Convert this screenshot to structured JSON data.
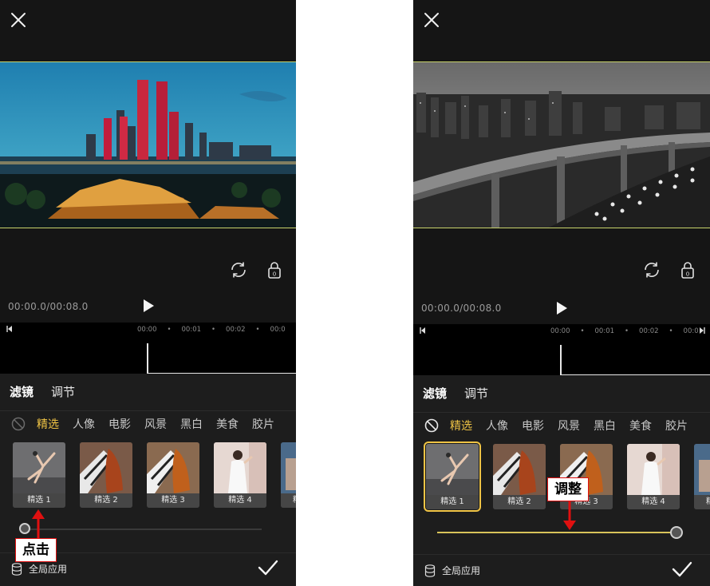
{
  "left": {
    "time": "00:00.0/00:08.0",
    "ruler": [
      "00:00",
      "•",
      "00:01",
      "•",
      "00:02",
      "•",
      "00:0"
    ],
    "tabs": [
      "滤镜",
      "调节"
    ],
    "categories": [
      "精选",
      "人像",
      "电影",
      "风景",
      "黑白",
      "美食",
      "胶片"
    ],
    "thumbs": [
      "精选 1",
      "精选 2",
      "精选 3",
      "精选 4",
      "精"
    ],
    "slider_value": 0,
    "global_label": "全局应用",
    "callout": "点击"
  },
  "right": {
    "time": "00:00.0/00:08.0",
    "ruler": [
      "00:00",
      "•",
      "00:01",
      "•",
      "00:02",
      "•",
      "00:0"
    ],
    "tabs": [
      "滤镜",
      "调节"
    ],
    "categories": [
      "精选",
      "人像",
      "电影",
      "风景",
      "黑白",
      "美食",
      "胶片"
    ],
    "thumbs": [
      "精选 1",
      "精选 2",
      "精选 3",
      "精选 4",
      "精"
    ],
    "selected_index": 0,
    "slider_value": 1.0,
    "global_label": "全局应用",
    "callout": "调整"
  },
  "colors": {
    "accent": "#f0c445",
    "callout_border": "#e01010",
    "frame_border": "#c8d36b"
  },
  "icons": [
    "close-icon",
    "rotate-icon",
    "lock-icon",
    "play-icon",
    "no-filter-icon",
    "database-icon",
    "check-icon"
  ]
}
